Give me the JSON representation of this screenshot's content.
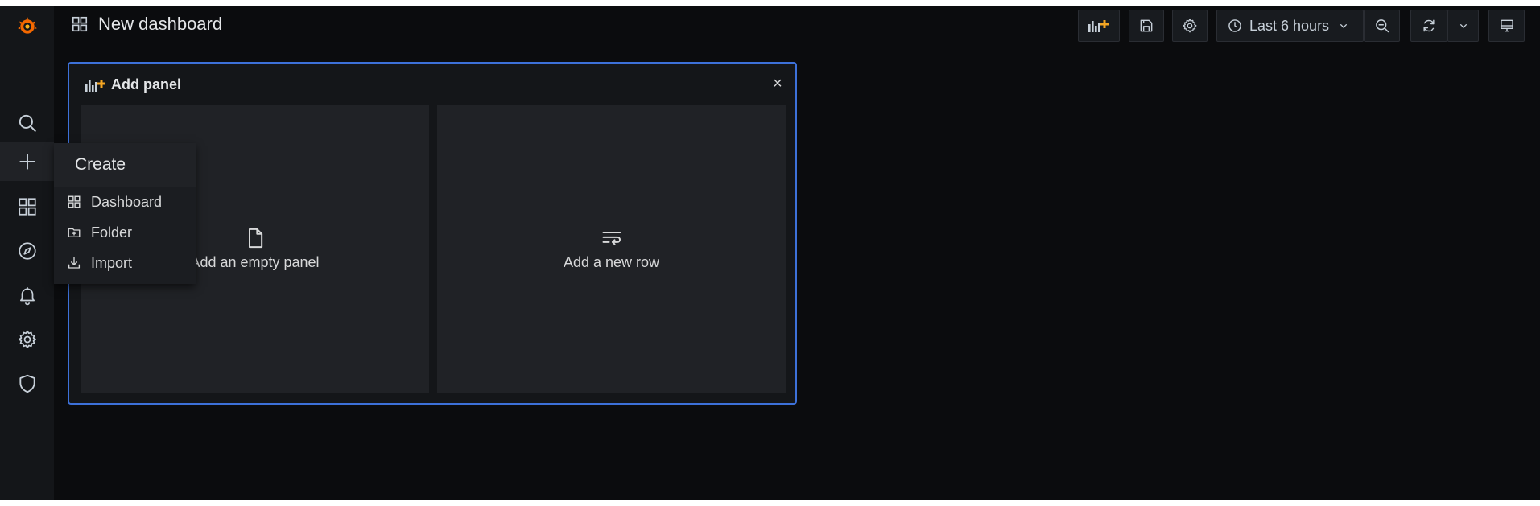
{
  "header": {
    "title": "New dashboard",
    "time_range": "Last 6 hours"
  },
  "sidebar": {
    "items": [
      {
        "icon": "grafana-logo-icon"
      },
      {
        "icon": "search-icon"
      },
      {
        "icon": "plus-icon"
      },
      {
        "icon": "dashboards-icon"
      },
      {
        "icon": "explore-compass-icon"
      },
      {
        "icon": "alerting-bell-icon"
      },
      {
        "icon": "configuration-gear-icon"
      },
      {
        "icon": "server-admin-shield-icon"
      }
    ]
  },
  "create_menu": {
    "title": "Create",
    "items": [
      {
        "label": "Dashboard",
        "icon": "apps-icon"
      },
      {
        "label": "Folder",
        "icon": "folder-plus-icon"
      },
      {
        "label": "Import",
        "icon": "import-icon"
      }
    ]
  },
  "add_panel": {
    "title": "Add panel",
    "close_label": "×",
    "empty_panel_label": "Add an empty panel",
    "new_row_label": "Add a new row"
  },
  "colors": {
    "background": "#0b0c0e",
    "sidebar": "#141619",
    "accent_border": "#3d71d9",
    "logo_orange": "#f46800",
    "add_icon_orange": "#f5a623"
  }
}
